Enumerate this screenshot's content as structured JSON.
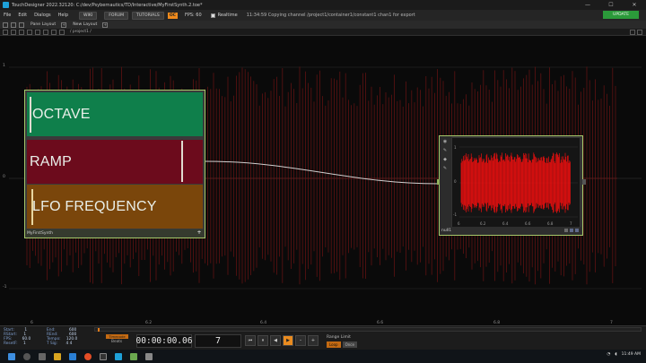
{
  "window": {
    "title": "TouchDesigner 2022.32120: C:/dev/Psybernautics/TD/Interactive/MyFirstSynth.2.toe*",
    "controls": [
      "—",
      "☐",
      "✕"
    ]
  },
  "menu": {
    "items": [
      "File",
      "Edit",
      "Dialogs",
      "Help"
    ],
    "wiki": "WIKI",
    "forum": "FORUM",
    "tutorials": "TUTORIALS",
    "oc_badge": "OC",
    "fps": "FPS: 60",
    "realtime": "Realtime",
    "status": "11:34:59 Copying channel /project1/container1/constant1 chan1 for export",
    "update": "UPDATE"
  },
  "panes": {
    "pane_layout": "Pane Layout",
    "new_layout": "New Layout",
    "path": "/ project1 /"
  },
  "axes": {
    "y_labels": [
      "1",
      "0",
      "-1"
    ],
    "x_labels": [
      "6",
      "6.2",
      "6.4",
      "6.6",
      "6.8",
      "7"
    ]
  },
  "comp": {
    "rows": [
      "OCTAVE",
      "RAMP",
      "LFO FREQUENCY"
    ],
    "name": "MyFirstSynth"
  },
  "chop": {
    "name": "null1",
    "y_ticks": [
      "1",
      "0",
      "-1"
    ],
    "x_ticks": [
      "6",
      "6.2",
      "6.4",
      "6.6",
      "6.8",
      "7"
    ]
  },
  "timeline": {
    "info_keys": [
      "Start:",
      "RStart:",
      "FPS:",
      "ResetF:"
    ],
    "info_vals": [
      "1",
      "1",
      "60.0",
      "1"
    ],
    "info2_keys": [
      "End:",
      "REnd:",
      "Tempo:",
      "T Sig:"
    ],
    "info2_vals": [
      "600",
      "600",
      "120.0",
      "4   4"
    ],
    "timecode_label": "Timecode",
    "beats_label": "Beats",
    "timecode": "00:00:00.06",
    "frame": "7",
    "transport": [
      "⏮",
      "⏸",
      "◀",
      "▶",
      "–",
      "+"
    ],
    "range_label": "Range Limit",
    "range_loop": "Loop",
    "range_once": "Once"
  },
  "taskbar": {
    "clock": "11:49 AM"
  }
}
